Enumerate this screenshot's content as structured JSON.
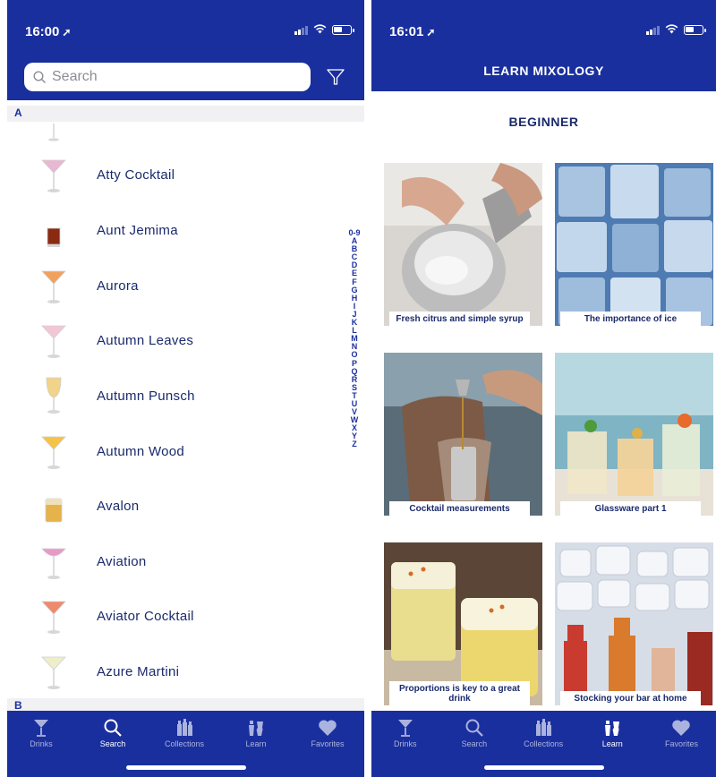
{
  "left": {
    "status": {
      "time": "16:00"
    },
    "search": {
      "placeholder": "Search"
    },
    "sections": {
      "a": "A",
      "b": "B"
    },
    "drinks": [
      {
        "name": "Atty Cocktail",
        "glass": "martini",
        "color": "#e9b7d3"
      },
      {
        "name": "Aunt Jemima",
        "glass": "shot",
        "color": "#8a2a12"
      },
      {
        "name": "Aurora",
        "glass": "martini",
        "color": "#f0a25c"
      },
      {
        "name": "Autumn Leaves",
        "glass": "martini",
        "color": "#f3c6d6"
      },
      {
        "name": "Autumn Punsch",
        "glass": "wine",
        "color": "#f2d38a"
      },
      {
        "name": "Autumn Wood",
        "glass": "martini",
        "color": "#f5c24a"
      },
      {
        "name": "Avalon",
        "glass": "rocks",
        "color": "#e6b24a"
      },
      {
        "name": "Aviation",
        "glass": "coupe",
        "color": "#e79ac8"
      },
      {
        "name": "Aviator Cocktail",
        "glass": "martini",
        "color": "#ee8a6b"
      },
      {
        "name": "Azure Martini",
        "glass": "martini",
        "color": "#efeeca"
      }
    ],
    "index": [
      "0-9",
      "A",
      "B",
      "C",
      "D",
      "E",
      "F",
      "G",
      "H",
      "I",
      "J",
      "K",
      "L",
      "M",
      "N",
      "O",
      "P",
      "Q",
      "R",
      "S",
      "T",
      "U",
      "V",
      "W",
      "X",
      "Y",
      "Z"
    ],
    "active_tab": "Search"
  },
  "right": {
    "status": {
      "time": "16:01"
    },
    "title": "LEARN MIXOLOGY",
    "level": "BEGINNER",
    "cards": [
      {
        "caption": "Fresh citrus and simple syrup",
        "image": "pouring-syrup-photo"
      },
      {
        "caption": "The importance of ice",
        "image": "ice-cubes-photo"
      },
      {
        "caption": "Cocktail measurements",
        "image": "jigger-pour-photo"
      },
      {
        "caption": "Glassware part 1",
        "image": "glassware-photo"
      },
      {
        "caption": "Proportions is key to a great drink",
        "image": "sour-cocktails-photo"
      },
      {
        "caption": "Stocking your bar at home",
        "image": "bottles-on-ice-photo"
      }
    ],
    "active_tab": "Learn"
  },
  "tabs": [
    {
      "label": "Drinks",
      "icon": "cocktail-glass-icon"
    },
    {
      "label": "Search",
      "icon": "search-icon"
    },
    {
      "label": "Collections",
      "icon": "bottles-icon"
    },
    {
      "label": "Learn",
      "icon": "shaker-icon"
    },
    {
      "label": "Favorites",
      "icon": "heart-icon"
    }
  ],
  "colors": {
    "brand": "#1a2f9e",
    "text": "#1a2a6c",
    "section_bg": "#f1f1f4"
  }
}
